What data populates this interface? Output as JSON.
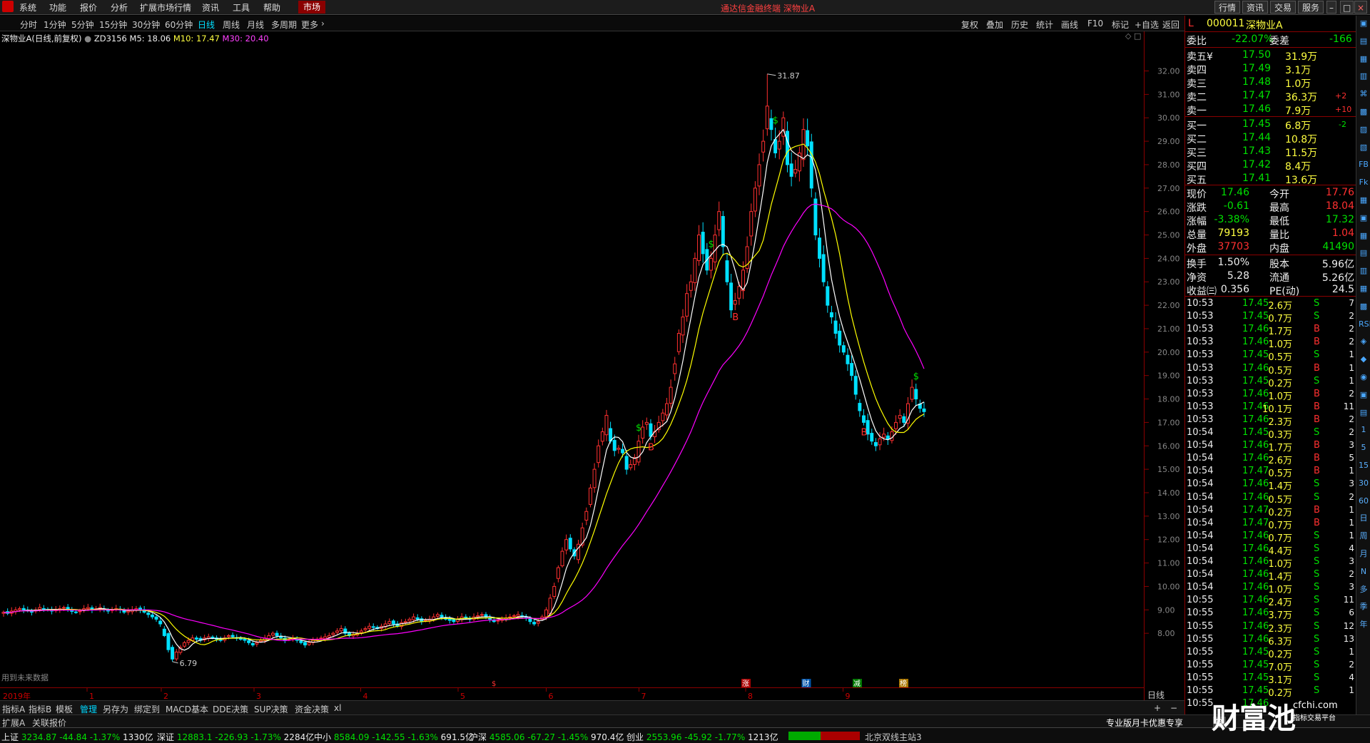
{
  "menu": {
    "items": [
      "系统",
      "功能",
      "报价",
      "分析",
      "扩展市场行情",
      "资讯",
      "工具",
      "帮助"
    ],
    "market_tab": "市场",
    "app_title": "通达信金融终端  深物业A",
    "right_buttons": [
      "行情",
      "资讯",
      "交易",
      "服务"
    ]
  },
  "period_bar": {
    "items": [
      "分时",
      "1分钟",
      "5分钟",
      "15分钟",
      "30分钟",
      "60分钟",
      "日线",
      "周线",
      "月线",
      "多周期",
      "更多"
    ],
    "active": "日线",
    "right_tools": [
      "复权",
      "叠加",
      "历史",
      "统计",
      "画线",
      "F10",
      "标记",
      "+自选",
      "返回"
    ]
  },
  "chart_info": {
    "name": "深物业A(日线,前复权)",
    "zd": "ZD3156",
    "m5_label": "M5: 18.06",
    "m10_label": "M10: 17.47",
    "m30_label": "M30: 20.40",
    "high_label": "31.87",
    "low_label": "6.79",
    "bottom_hint": "用到未来数据",
    "year_label": "2019年",
    "month_labels": [
      "1",
      "2",
      "3",
      "4",
      "5",
      "6",
      "7",
      "8",
      "9"
    ],
    "event_markers": [
      "$",
      "涨",
      "财",
      "减",
      "榜"
    ],
    "buy_signal": "B",
    "sell_signal": "$",
    "period_label": "日线"
  },
  "colors": {
    "up": "#ff3030",
    "down": "#00e0ff",
    "m5": "#ffffff",
    "m10": "#ffff00",
    "m30": "#ff00ff",
    "axis_border": "#8b0000"
  },
  "chart_data": {
    "type": "candlestick",
    "ylim": [
      6,
      32.5
    ],
    "y_ticks": [
      "32.00",
      "31.00",
      "30.00",
      "29.00",
      "28.00",
      "27.00",
      "26.00",
      "25.00",
      "24.00",
      "23.00",
      "22.00",
      "21.00",
      "20.00",
      "19.00",
      "18.00",
      "17.00",
      "16.00",
      "15.00",
      "14.00",
      "13.00",
      "12.00",
      "11.00",
      "10.00",
      "9.00",
      "8.00"
    ],
    "close": [
      8.9,
      8.85,
      8.95,
      9.0,
      9.05,
      9.0,
      8.95,
      8.9,
      9.0,
      9.1,
      9.05,
      9.0,
      8.95,
      9.0,
      9.05,
      9.1,
      9.0,
      8.95,
      8.9,
      8.95,
      9.05,
      9.1,
      9.0,
      9.05,
      9.1,
      9.0,
      8.95,
      9.0,
      9.05,
      9.0,
      8.9,
      8.95,
      9.0,
      9.05,
      9.0,
      8.9,
      8.8,
      8.7,
      8.6,
      8.4,
      7.9,
      7.3,
      6.9,
      7.2,
      7.4,
      7.6,
      7.7,
      7.8,
      7.75,
      7.7,
      7.8,
      7.85,
      7.8,
      7.75,
      7.7,
      7.8,
      7.9,
      7.85,
      7.8,
      7.75,
      7.7,
      7.6,
      7.5,
      7.6,
      7.7,
      7.8,
      7.9,
      8.0,
      7.9,
      7.8,
      7.7,
      7.75,
      7.8,
      7.7,
      7.6,
      7.5,
      7.6,
      7.7,
      7.75,
      7.8,
      7.85,
      7.9,
      8.0,
      8.1,
      8.2,
      8.0,
      7.9,
      7.95,
      8.0,
      8.1,
      8.2,
      8.3,
      8.25,
      8.2,
      8.3,
      8.4,
      8.5,
      8.4,
      8.3,
      8.45,
      8.5,
      8.6,
      8.7,
      8.6,
      8.5,
      8.55,
      8.6,
      8.7,
      8.8,
      8.7,
      8.6,
      8.55,
      8.5,
      8.6,
      8.7,
      8.65,
      8.6,
      8.7,
      8.75,
      8.8,
      8.7,
      8.6,
      8.5,
      8.55,
      8.6,
      8.65,
      8.7,
      8.75,
      8.8,
      8.7,
      8.65,
      8.5,
      8.4,
      8.5,
      8.7,
      9.0,
      9.5,
      10.0,
      10.8,
      11.5,
      12.0,
      11.6,
      11.3,
      11.8,
      12.5,
      13.2,
      14.2,
      15.0,
      16.0,
      16.6,
      17.3,
      16.2,
      15.8,
      15.9,
      15.7,
      15.0,
      15.2,
      15.5,
      16.2,
      16.8,
      17.0,
      16.4,
      16.6,
      17.0,
      17.4,
      17.8,
      18.5,
      19.5,
      20.8,
      21.5,
      22.5,
      23.0,
      24.0,
      25.0,
      24.2,
      23.5,
      24.0,
      25.0,
      26.0,
      24.5,
      23.0,
      21.8,
      22.2,
      22.8,
      23.5,
      24.5,
      26.0,
      27.0,
      28.0,
      29.0,
      30.5,
      29.5,
      28.5,
      29.0,
      30.0,
      28.0,
      27.5,
      27.8,
      28.5,
      29.5,
      28.8,
      27.0,
      25.0,
      24.0,
      23.0,
      22.0,
      21.5,
      20.8,
      20.3,
      20.0,
      19.5,
      19.0,
      18.2,
      17.5,
      17.0,
      16.5,
      16.2,
      16.0,
      16.3,
      16.5,
      16.3,
      16.6,
      17.0,
      17.3,
      17.0,
      17.8,
      18.5,
      18.0,
      17.6,
      17.46
    ],
    "m5": 18.06,
    "m10": 17.47,
    "m30": 20.4,
    "high": 31.87,
    "low": 6.79
  },
  "side_panel": {
    "code": "000011",
    "name": "深物业A",
    "badge": "L",
    "weibi": {
      "label": "委比",
      "value": "-22.07%",
      "label2": "委差",
      "value2": "-166"
    },
    "asks": [
      {
        "label": "卖五",
        "flag": "¥",
        "price": "17.50",
        "vol": "31.9万",
        "chg": ""
      },
      {
        "label": "卖四",
        "flag": "",
        "price": "17.49",
        "vol": "3.1万",
        "chg": ""
      },
      {
        "label": "卖三",
        "flag": "",
        "price": "17.48",
        "vol": "1.0万",
        "chg": ""
      },
      {
        "label": "卖二",
        "flag": "",
        "price": "17.47",
        "vol": "36.3万",
        "chg": "+2"
      },
      {
        "label": "卖一",
        "flag": "",
        "price": "17.46",
        "vol": "7.9万",
        "chg": "+10"
      }
    ],
    "bids": [
      {
        "label": "买一",
        "price": "17.45",
        "vol": "6.8万",
        "chg": "-2"
      },
      {
        "label": "买二",
        "price": "17.44",
        "vol": "10.8万",
        "chg": ""
      },
      {
        "label": "买三",
        "price": "17.43",
        "vol": "11.5万",
        "chg": ""
      },
      {
        "label": "买四",
        "price": "17.42",
        "vol": "8.4万",
        "chg": ""
      },
      {
        "label": "买五",
        "price": "17.41",
        "vol": "13.6万",
        "chg": ""
      }
    ],
    "stats": [
      {
        "l1": "现价",
        "v1": "17.46",
        "c1": "grn",
        "l2": "今开",
        "v2": "17.76",
        "c2": "red"
      },
      {
        "l1": "涨跌",
        "v1": "-0.61",
        "c1": "grn",
        "l2": "最高",
        "v2": "18.04",
        "c2": "red"
      },
      {
        "l1": "涨幅",
        "v1": "-3.38%",
        "c1": "grn",
        "l2": "最低",
        "v2": "17.32",
        "c2": "grn"
      },
      {
        "l1": "总量",
        "v1": "79193",
        "c1": "yel",
        "l2": "量比",
        "v2": "1.04",
        "c2": "red"
      },
      {
        "l1": "外盘",
        "v1": "37703",
        "c1": "red",
        "l2": "内盘",
        "v2": "41490",
        "c2": "grn"
      }
    ],
    "stats2": [
      {
        "l1": "换手",
        "v1": "1.50%",
        "l2": "股本",
        "v2": "5.96亿"
      },
      {
        "l1": "净资",
        "v1": "5.28",
        "l2": "流通",
        "v2": "5.26亿"
      },
      {
        "l1": "收益㈢",
        "v1": "0.356",
        "l2": "PE(动)",
        "v2": "24.5"
      }
    ],
    "ticks": [
      {
        "t": "10:53",
        "p": "17.45",
        "v": "2.6万",
        "d": "S",
        "n": "7"
      },
      {
        "t": "10:53",
        "p": "17.45",
        "v": "0.7万",
        "d": "S",
        "n": "2"
      },
      {
        "t": "10:53",
        "p": "17.46",
        "v": "1.7万",
        "d": "B",
        "n": "2"
      },
      {
        "t": "10:53",
        "p": "17.46",
        "v": "1.0万",
        "d": "B",
        "n": "2"
      },
      {
        "t": "10:53",
        "p": "17.45",
        "v": "0.5万",
        "d": "S",
        "n": "1"
      },
      {
        "t": "10:53",
        "p": "17.46",
        "v": "0.5万",
        "d": "B",
        "n": "1"
      },
      {
        "t": "10:53",
        "p": "17.45",
        "v": "0.2万",
        "d": "S",
        "n": "1"
      },
      {
        "t": "10:53",
        "p": "17.46",
        "v": "1.0万",
        "d": "B",
        "n": "2"
      },
      {
        "t": "10:53",
        "p": "17.46",
        "v": "10.1万",
        "d": "B",
        "n": "11"
      },
      {
        "t": "10:53",
        "p": "17.46",
        "v": "2.3万",
        "d": "B",
        "n": "2"
      },
      {
        "t": "10:54",
        "p": "17.45",
        "v": "0.3万",
        "d": "S",
        "n": "2"
      },
      {
        "t": "10:54",
        "p": "17.46",
        "v": "1.7万",
        "d": "B",
        "n": "3"
      },
      {
        "t": "10:54",
        "p": "17.46",
        "v": "2.6万",
        "d": "B",
        "n": "5"
      },
      {
        "t": "10:54",
        "p": "17.47",
        "v": "0.5万",
        "d": "B",
        "n": "1"
      },
      {
        "t": "10:54",
        "p": "17.46",
        "v": "1.4万",
        "d": "S",
        "n": "3"
      },
      {
        "t": "10:54",
        "p": "17.46",
        "v": "0.5万",
        "d": "S",
        "n": "2"
      },
      {
        "t": "10:54",
        "p": "17.47",
        "v": "0.2万",
        "d": "B",
        "n": "1"
      },
      {
        "t": "10:54",
        "p": "17.47",
        "v": "0.7万",
        "d": "B",
        "n": "1"
      },
      {
        "t": "10:54",
        "p": "17.46",
        "v": "0.7万",
        "d": "S",
        "n": "1"
      },
      {
        "t": "10:54",
        "p": "17.46",
        "v": "4.4万",
        "d": "S",
        "n": "4"
      },
      {
        "t": "10:54",
        "p": "17.46",
        "v": "1.0万",
        "d": "S",
        "n": "3"
      },
      {
        "t": "10:54",
        "p": "17.46",
        "v": "1.4万",
        "d": "S",
        "n": "2"
      },
      {
        "t": "10:54",
        "p": "17.46",
        "v": "1.0万",
        "d": "S",
        "n": "3"
      },
      {
        "t": "10:55",
        "p": "17.46",
        "v": "2.4万",
        "d": "S",
        "n": "11"
      },
      {
        "t": "10:55",
        "p": "17.46",
        "v": "3.7万",
        "d": "S",
        "n": "6"
      },
      {
        "t": "10:55",
        "p": "17.46",
        "v": "2.3万",
        "d": "S",
        "n": "12"
      },
      {
        "t": "10:55",
        "p": "17.46",
        "v": "6.3万",
        "d": "S",
        "n": "13"
      },
      {
        "t": "10:55",
        "p": "17.45",
        "v": "0.2万",
        "d": "S",
        "n": "1"
      },
      {
        "t": "10:55",
        "p": "17.45",
        "v": "7.0万",
        "d": "S",
        "n": "2"
      },
      {
        "t": "10:55",
        "p": "17.45",
        "v": "3.1万",
        "d": "S",
        "n": "4"
      },
      {
        "t": "10:55",
        "p": "17.45",
        "v": "0.2万",
        "d": "S",
        "n": "1"
      },
      {
        "t": "10:55",
        "p": "17.46",
        "v": "",
        "d": "",
        "n": ""
      }
    ],
    "side_icons": [
      "▣",
      "▤",
      "▦",
      "▥",
      "⌘",
      "▩",
      "▨",
      "▧",
      "FB",
      "Fk",
      "▦",
      "▣",
      "▦",
      "▤",
      "▥",
      "▦",
      "▩",
      "RSI",
      "◈",
      "◆",
      "◉",
      "▣",
      "▤",
      "1",
      "5",
      "15",
      "30",
      "60",
      "日",
      "周",
      "月",
      "N",
      "多",
      "季",
      "年"
    ]
  },
  "bottom_tabs": {
    "items": [
      "指标A",
      "指标B",
      "模板",
      "管理",
      "另存为",
      "绑定到",
      "MACD基本",
      "DDE决策",
      "SUP决策",
      "资金决策",
      "xl"
    ],
    "active": "管理"
  },
  "bottom2": {
    "left": [
      "扩展A",
      "关联报价"
    ],
    "right": "专业版月卡优惠专享",
    "pen": "笔"
  },
  "status": {
    "items": [
      {
        "name": "上证",
        "price": "3234.87",
        "chg": "-44.84",
        "pct": "-1.37%",
        "amt": "1330亿"
      },
      {
        "name": "深证",
        "price": "12883.1",
        "chg": "-226.93",
        "pct": "-1.73%",
        "amt": "2284亿"
      },
      {
        "name": "中小",
        "price": "8584.09",
        "chg": "-142.55",
        "pct": "-1.63%",
        "amt": "691.5亿"
      },
      {
        "name": "沪深",
        "price": "4585.06",
        "chg": "-67.27",
        "pct": "-1.45%",
        "amt": "970.4亿"
      },
      {
        "name": "创业",
        "price": "2553.96",
        "chg": "-45.92",
        "pct": "-1.77%",
        "amt": "1213亿"
      }
    ],
    "server": "北京双线主站3"
  },
  "watermark": {
    "main": "财富池",
    "site": "cfchi.com",
    "sub": "指标交易平台"
  }
}
